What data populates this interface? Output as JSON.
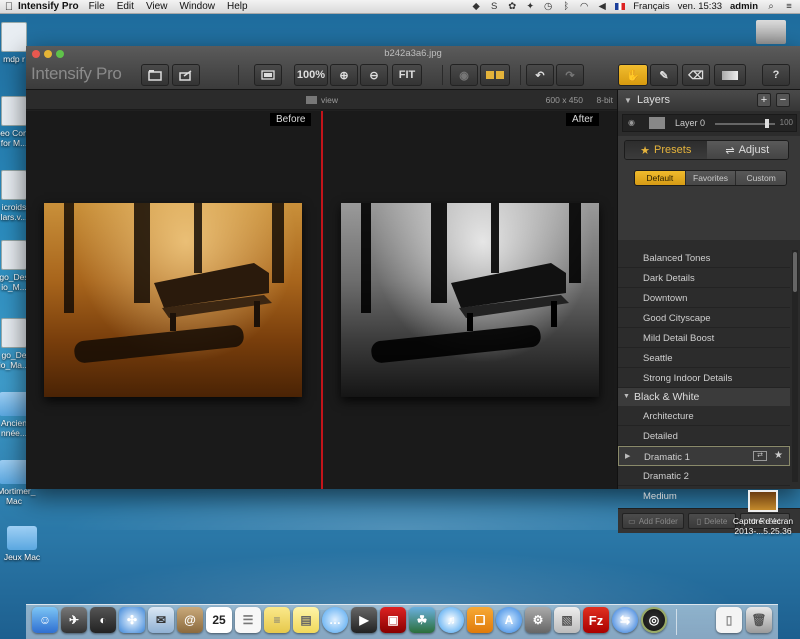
{
  "menubar": {
    "app_name": "Intensify Pro",
    "menus": [
      "File",
      "Edit",
      "View",
      "Window",
      "Help"
    ],
    "language": "Français",
    "clock": "ven. 15:33",
    "user": "admin"
  },
  "desktop_icons": [
    {
      "label": "mdp r",
      "type": "file"
    },
    {
      "label": "eo Con\nfor M...",
      "type": "file"
    },
    {
      "label": "icroids\nlars.v...",
      "type": "file"
    },
    {
      "label": "go_Des\nio_M...",
      "type": "file"
    },
    {
      "label": "go_De\nio_Ma...",
      "type": "file"
    },
    {
      "label": "Ancien\nnnée...",
      "type": "folder"
    },
    {
      "label": "_Mortimer_\nMac",
      "type": "folder"
    },
    {
      "label": "Jeux Mac",
      "type": "folder"
    }
  ],
  "capture_file": {
    "label": "Capture d'écran\n2013-...5.25.36"
  },
  "window": {
    "title": "b242a3a6.jpg",
    "brand": "Intensify Pro",
    "toolbar": {
      "zoom_label": "100%",
      "fit_label": "FIT",
      "help_label": "?"
    },
    "viewbar": {
      "view_label": "view",
      "dimensions": "600 x 450",
      "bit_depth": "8-bit"
    },
    "canvas": {
      "before_label": "Before",
      "after_label": "After"
    }
  },
  "panel": {
    "layers_title": "Layers",
    "layer": {
      "name": "Layer 0",
      "opacity": "100"
    },
    "tabs": [
      {
        "label": "Presets",
        "active": true
      },
      {
        "label": "Adjust",
        "active": false
      }
    ],
    "subtabs": [
      {
        "label": "Default",
        "active": true
      },
      {
        "label": "Favorites",
        "active": false
      },
      {
        "label": "Custom",
        "active": false
      }
    ],
    "presets_group1": [
      "Balanced Tones",
      "Dark Details",
      "Downtown",
      "Good Cityscape",
      "Mild Detail Boost",
      "Seattle",
      "Strong Indoor Details"
    ],
    "group2_title": "Black & White",
    "presets_group2": [
      "Architecture",
      "Detailed",
      "Dramatic 1",
      "Dramatic 2",
      "Medium"
    ],
    "selected_preset": "Dramatic 1",
    "footer": {
      "add_folder": "Add Folder",
      "delete": "Delete",
      "reset": "Reset"
    }
  },
  "dock": {
    "items": [
      "finder",
      "launchpad",
      "dashboard",
      "safari",
      "mail",
      "contacts",
      "calendar",
      "reminders",
      "notes",
      "stickies",
      "messages",
      "facetime",
      "photo-booth",
      "iphoto",
      "itunes",
      "ibooks",
      "app-store",
      "system-preferences",
      "preview",
      "filezilla",
      "teamviewer",
      "intensify",
      "documents",
      "trash"
    ],
    "calendar_day": "25",
    "filezilla_letter": "Fz"
  }
}
